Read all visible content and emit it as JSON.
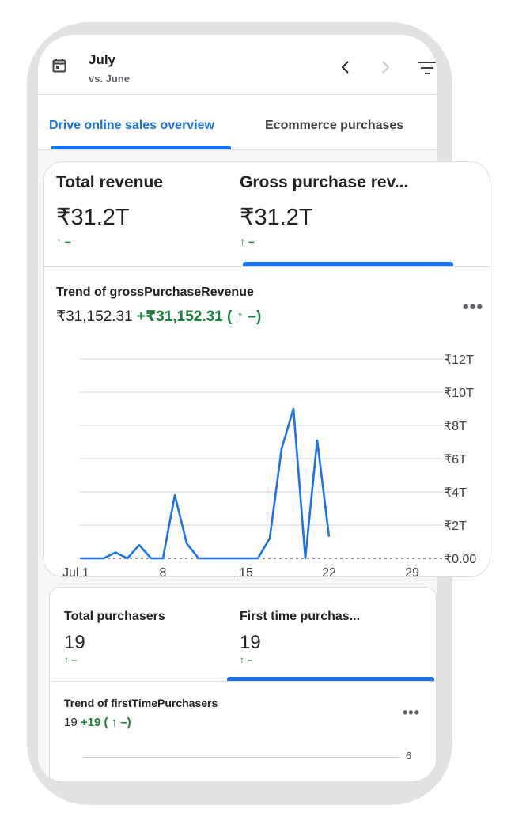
{
  "header": {
    "month": "July",
    "comparison": "vs. June",
    "icons": {
      "calendar": "calendar-icon",
      "prev": "chevron-left-icon",
      "next": "chevron-right-icon",
      "filter": "filter-icon"
    }
  },
  "tabs": [
    {
      "label": "Drive online sales overview",
      "active": true
    },
    {
      "label": "Ecommerce purchases",
      "active": false
    }
  ],
  "main_card": {
    "metrics": [
      {
        "title": "Total revenue",
        "value": "₹31.2T",
        "delta": "↑ –"
      },
      {
        "title": "Gross purchase rev...",
        "value": "₹31.2T",
        "delta": "↑ –",
        "selected": true
      }
    ],
    "trend": {
      "title": "Trend of grossPurchaseRevenue",
      "value": "₹31,152.31",
      "change": "+₹31,152.31 ( ↑ –)"
    },
    "more_label": "•••"
  },
  "second_card": {
    "metrics": [
      {
        "title": "Total purchasers",
        "value": "19",
        "delta": "↑ –"
      },
      {
        "title": "First time purchas...",
        "value": "19",
        "delta": "↑ –",
        "selected": true
      }
    ],
    "trend": {
      "title": "Trend of firstTimePurchasers",
      "value": "19",
      "change": "+19 ( ↑ –)"
    },
    "more_label": "•••",
    "y_tick": "6"
  },
  "colors": {
    "accent": "#1a73e8",
    "positive": "#188038",
    "line": "#1a73e8"
  },
  "chart_data": {
    "type": "line",
    "title": "Trend of grossPurchaseRevenue",
    "x_tick_labels": [
      "Jul 1",
      "8",
      "15",
      "22",
      "29"
    ],
    "x_ticks": [
      1,
      8,
      15,
      22,
      29
    ],
    "y_tick_labels": [
      "₹0.00",
      "₹2T",
      "₹4T",
      "₹6T",
      "₹8T",
      "₹10T",
      "₹12T"
    ],
    "y_ticks": [
      0,
      2,
      4,
      6,
      8,
      10,
      12
    ],
    "ylim": [
      0,
      12
    ],
    "xlim": [
      1,
      31
    ],
    "y_unit": "T",
    "grid": true,
    "series": [
      {
        "x": [
          1,
          2,
          3,
          4,
          5,
          6,
          7,
          8,
          9,
          10,
          11,
          12,
          13,
          14,
          15,
          16,
          17,
          18,
          19,
          20,
          21,
          22
        ],
        "y": [
          0,
          0,
          0,
          0.35,
          0,
          0.8,
          0,
          0,
          3.8,
          0.9,
          0,
          0,
          0,
          0,
          0,
          0,
          1.2,
          6.6,
          9.0,
          0,
          7.1,
          1.3
        ]
      }
    ],
    "comparison_series_dashed_zero": true
  }
}
